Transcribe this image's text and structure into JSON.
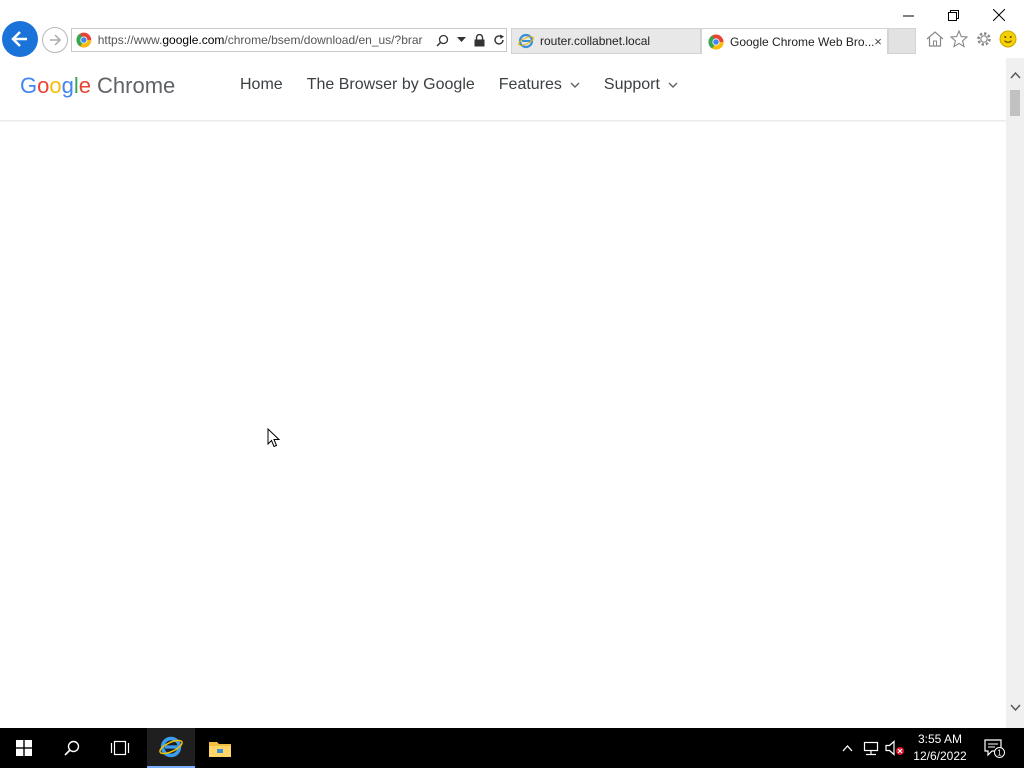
{
  "browser": {
    "url_prefix": "https://www.",
    "url_host": "google.com",
    "url_rest": "/chrome/bsem/download/en_us/?brar",
    "tabs": [
      {
        "label": "router.collabnet.local",
        "active": false
      },
      {
        "label": "Google Chrome Web Bro...",
        "active": true
      }
    ],
    "tab_close_glyph": "×"
  },
  "site": {
    "logo_word_letters": [
      "G",
      "o",
      "o",
      "g",
      "l",
      "e"
    ],
    "logo_product": "Chrome",
    "nav": [
      {
        "label": "Home",
        "has_dropdown": false
      },
      {
        "label": "The Browser by Google",
        "has_dropdown": false
      },
      {
        "label": "Features",
        "has_dropdown": true
      },
      {
        "label": "Support",
        "has_dropdown": true
      }
    ]
  },
  "taskbar": {
    "time": "3:55 AM",
    "date": "12/6/2022",
    "notification_count": "1"
  },
  "colors": {
    "accent_blue": "#1a73d9",
    "google_blue": "#4285f4",
    "google_red": "#ea4335",
    "google_yellow": "#fbbc05",
    "google_green": "#34a853"
  }
}
